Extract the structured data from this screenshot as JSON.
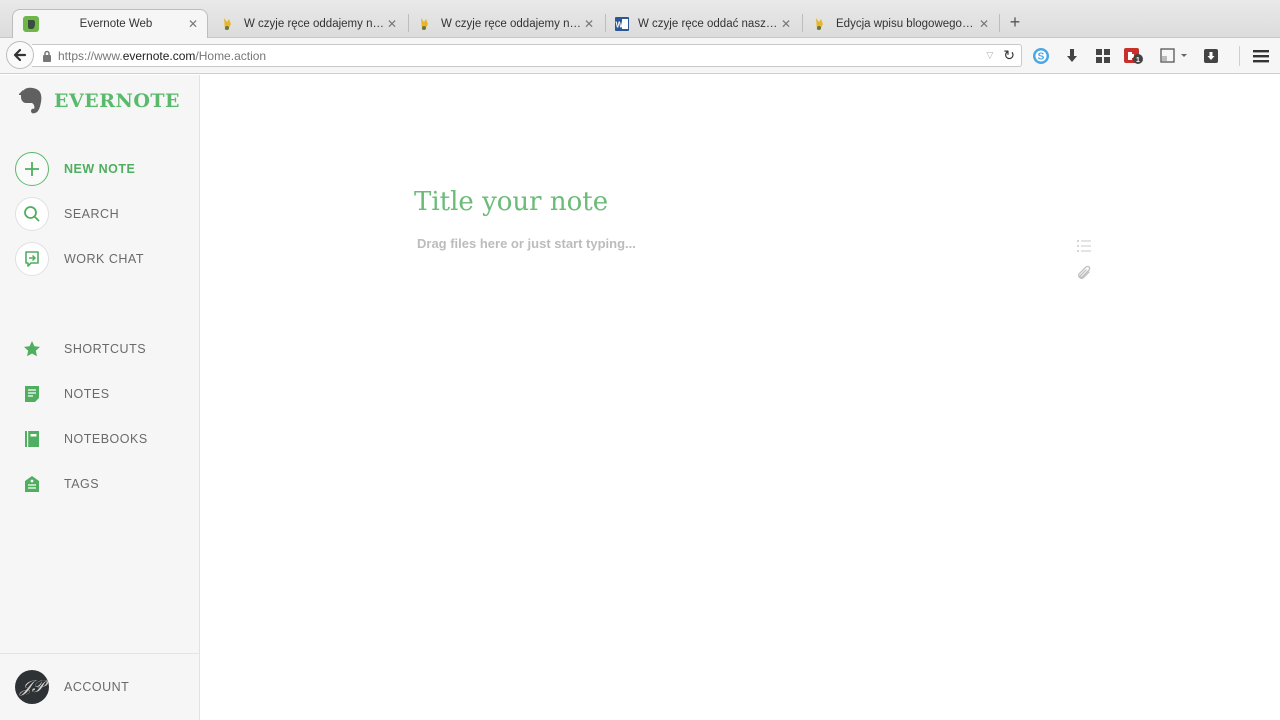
{
  "browser": {
    "tabs": [
      {
        "title": "Evernote Web",
        "active": true,
        "favicon": "evernote-favicon"
      },
      {
        "title": "W czyje ręce oddajemy nas…",
        "active": false,
        "favicon": "blog-favicon"
      },
      {
        "title": "W czyje ręce oddajemy nas…",
        "active": false,
        "favicon": "blog-favicon"
      },
      {
        "title": "W czyje ręce oddać nasze n…",
        "active": false,
        "favicon": "word-favicon"
      },
      {
        "title": "Edycja wpisu blogowego - …",
        "active": false,
        "favicon": "blog-favicon"
      }
    ],
    "new_tab_label": "+",
    "url": {
      "prefix": "https://www.",
      "domain": "evernote.com",
      "path": "/Home.action"
    },
    "toolbar_icons": [
      "skype-icon",
      "download-arrow-icon",
      "grid-icon",
      "extension-badge-icon",
      "reader-view-icon",
      "pocket-download-icon"
    ]
  },
  "sidebar": {
    "brand": "EVERNOTE",
    "primary": [
      {
        "label": "NEW NOTE",
        "icon": "plus-icon"
      },
      {
        "label": "SEARCH",
        "icon": "search-icon"
      },
      {
        "label": "WORK CHAT",
        "icon": "chat-icon"
      }
    ],
    "secondary": [
      {
        "label": "SHORTCUTS",
        "icon": "star-icon"
      },
      {
        "label": "NOTES",
        "icon": "note-icon"
      },
      {
        "label": "NOTEBOOKS",
        "icon": "notebook-icon"
      },
      {
        "label": "TAGS",
        "icon": "tag-icon"
      }
    ],
    "account": {
      "label": "ACCOUNT",
      "avatar_initials": "JP"
    }
  },
  "editor": {
    "title_placeholder": "Title your note",
    "title_value": "",
    "body_placeholder": "Drag files here or just start typing...",
    "body_value": ""
  },
  "colors": {
    "brand_green": "#5aba6b",
    "sidebar_bg": "#f6f6f6",
    "label_gray": "#6a6a6a"
  }
}
